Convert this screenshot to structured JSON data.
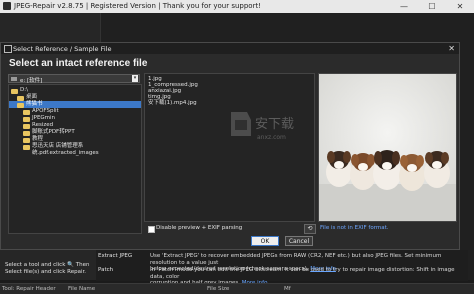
{
  "app": {
    "title": "JPEG-Repair v2.8.75 | Registered Version | Thank you for your support!",
    "window_controls": [
      "—",
      "☐",
      "✕"
    ]
  },
  "dialog": {
    "title": "Select Reference / Sample File",
    "heading": "Select an intact reference file",
    "drive": "e: [软件]",
    "tree": [
      {
        "label": "D:\\",
        "indent": 0,
        "selected": false
      },
      {
        "label": "桌面",
        "indent": 1,
        "selected": false
      },
      {
        "label": "熊猫书",
        "indent": 1,
        "selected": true
      },
      {
        "label": "APOFSplit",
        "indent": 2,
        "selected": false
      },
      {
        "label": "JPEGmin",
        "indent": 2,
        "selected": false
      },
      {
        "label": "Resized",
        "indent": 2,
        "selected": false
      },
      {
        "label": "脚账式PDF转PPT",
        "indent": 2,
        "selected": false
      },
      {
        "label": "教程",
        "indent": 2,
        "selected": false
      },
      {
        "label": "思迅天店 店铺管理系统.pdf.extracted_images",
        "indent": 2,
        "selected": false
      }
    ],
    "files": [
      "1.jpg",
      "1_compressed.jpg",
      "anxiazai.jpg",
      "timg.jpg",
      "安下载(1).mp4.jpg"
    ],
    "exif_note": "File is not in EXIF format.",
    "disable_preview_label": "Disable preview + EXIF parsing",
    "refresh_label": "⟲",
    "ok_label": "OK",
    "cancel_label": "Cancel",
    "close_label": "✕",
    "watermark_text": "安下载",
    "watermark_sub": "anxz.com"
  },
  "left_hint": "Select a tool and click 🔍 Then Select file(s) and click Repair.",
  "tools": [
    {
      "name": "Extract JPEG",
      "lines": [
        {
          "text": "Use 'Extract JPEG' to recover embedded JPEGs from RAW (CR2, NEF etc.) but also JPEG files. Set minimum resolution to a value just",
          "link": ""
        },
        {
          "text": "below expected/desired resolution (check camera specs). ",
          "link": "More info"
        }
      ]
    },
    {
      "name": "Patch",
      "lines": [
        {
          "text": "In 'Patch' mode you can edit the JPEG bitstream. It can be used to try to repair image distortion: Shift in image data, color",
          "link": ""
        },
        {
          "text": "corruption and half grey images. ",
          "link": "More info"
        }
      ]
    }
  ],
  "statusbar": {
    "col1": "Tool: Repair Header",
    "col2": "File Name",
    "col3": "File Size",
    "col4": "Mf"
  },
  "colors": {
    "accent": "#3c78c8",
    "link": "#6fa7ff",
    "background": "#202020"
  }
}
